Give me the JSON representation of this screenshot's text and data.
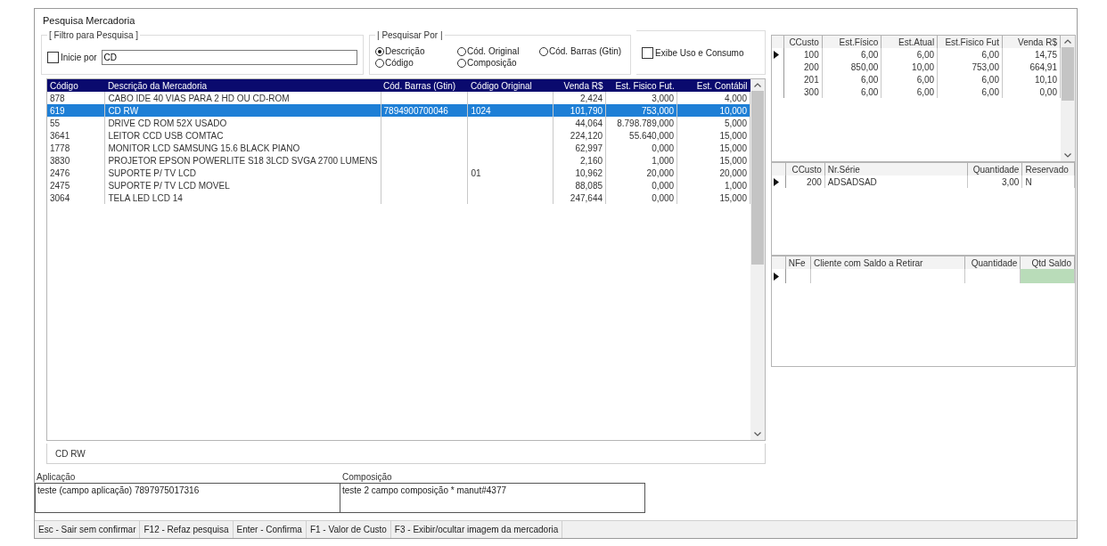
{
  "window": {
    "title": "Pesquisa Mercadoria"
  },
  "filter": {
    "legend": "[ Filtro para Pesquisa ]",
    "starts_with": {
      "label": "Inicie por",
      "checked": false
    },
    "search_value": "CD"
  },
  "search_by": {
    "legend": "| Pesquisar Por |",
    "options": [
      {
        "label": "Descrição",
        "selected": true
      },
      {
        "label": "Código",
        "selected": false
      },
      {
        "label": "Cód. Original",
        "selected": false
      },
      {
        "label": "Composição",
        "selected": false
      },
      {
        "label": "Cód. Barras (Gtin)",
        "selected": false
      }
    ]
  },
  "show_consumption": {
    "label": "Exibe Uso e Consumo",
    "checked": false
  },
  "table": {
    "columns": [
      "Código",
      "Descrição da Mercadoria",
      "Cód. Barras (Gtin)",
      "Código Original",
      "Venda R$",
      "Est. Fisico Fut.",
      "Est. Contábil"
    ],
    "rows": [
      {
        "cells": [
          "878",
          "CABO IDE 40 VIAS PARA 2 HD OU CD-ROM",
          "",
          "",
          "2,424",
          "3,000",
          "4,000"
        ],
        "selected": false
      },
      {
        "cells": [
          "619",
          "CD RW",
          "7894900700046",
          "1024",
          "101,790",
          "753,000",
          "10,000"
        ],
        "selected": true
      },
      {
        "cells": [
          "55",
          "DRIVE CD ROM 52X USADO",
          "",
          "",
          "44,064",
          "8.798.789,000",
          "5,000"
        ],
        "selected": false
      },
      {
        "cells": [
          "3641",
          "LEITOR CCD USB COMTAC",
          "",
          "",
          "224,120",
          "55.640,000",
          "15,000"
        ],
        "selected": false
      },
      {
        "cells": [
          "1778",
          "MONITOR LCD SAMSUNG 15.6 BLACK PIANO",
          "",
          "",
          "62,997",
          "0,000",
          "15,000"
        ],
        "selected": false
      },
      {
        "cells": [
          "3830",
          "PROJETOR EPSON POWERLITE S18 3LCD SVGA 2700 LUMENS",
          "",
          "",
          "2,160",
          "1,000",
          "15,000"
        ],
        "selected": false
      },
      {
        "cells": [
          "2476",
          "SUPORTE P/ TV LCD",
          "",
          "01",
          "10,962",
          "20,000",
          "20,000"
        ],
        "selected": false
      },
      {
        "cells": [
          "2475",
          "SUPORTE P/ TV LCD MOVEL",
          "",
          "",
          "88,085",
          "0,000",
          "1,000"
        ],
        "selected": false
      },
      {
        "cells": [
          "3064",
          "TELA LED LCD 14",
          "",
          "",
          "247,644",
          "0,000",
          "15,000"
        ],
        "selected": false
      }
    ]
  },
  "description": "CD RW",
  "application": {
    "label": "Aplicação",
    "value": "teste (campo aplicação) 7897975017316"
  },
  "composition": {
    "label": "Composição",
    "value": "teste 2 campo composição * manut#4377"
  },
  "stock_grid": {
    "columns": [
      "CCusto",
      "Est.Físico",
      "Est.Atual",
      "Est.Fisico Fut",
      "Venda R$"
    ],
    "rows": [
      {
        "cells": [
          "100",
          "6,00",
          "6,00",
          "6,00",
          "14,75"
        ],
        "current": true
      },
      {
        "cells": [
          "200",
          "850,00",
          "10,00",
          "753,00",
          "664,91"
        ],
        "current": false
      },
      {
        "cells": [
          "201",
          "6,00",
          "6,00",
          "6,00",
          "10,10"
        ],
        "current": false
      },
      {
        "cells": [
          "300",
          "6,00",
          "6,00",
          "6,00",
          "0,00"
        ],
        "current": false
      }
    ]
  },
  "serial_grid": {
    "columns": [
      "CCusto",
      "Nr.Série",
      "Quantidade",
      "Reservado"
    ],
    "rows": [
      {
        "cells": [
          "200",
          "ADSADSAD",
          "3,00",
          "N"
        ],
        "current": true
      }
    ]
  },
  "balance_grid": {
    "columns": [
      "NFe",
      "Cliente com Saldo a Retirar",
      "Quantidade",
      "Qtd Saldo"
    ],
    "rows": [
      {
        "cells": [
          "",
          "",
          "",
          ""
        ],
        "current": true
      }
    ]
  },
  "status_bar": [
    "Esc - Sair sem confirmar",
    "F12 - Refaz pesquisa",
    "Enter - Confirma",
    "F1 - Valor de Custo",
    "F3 - Exibir/ocultar imagem da mercadoria"
  ]
}
